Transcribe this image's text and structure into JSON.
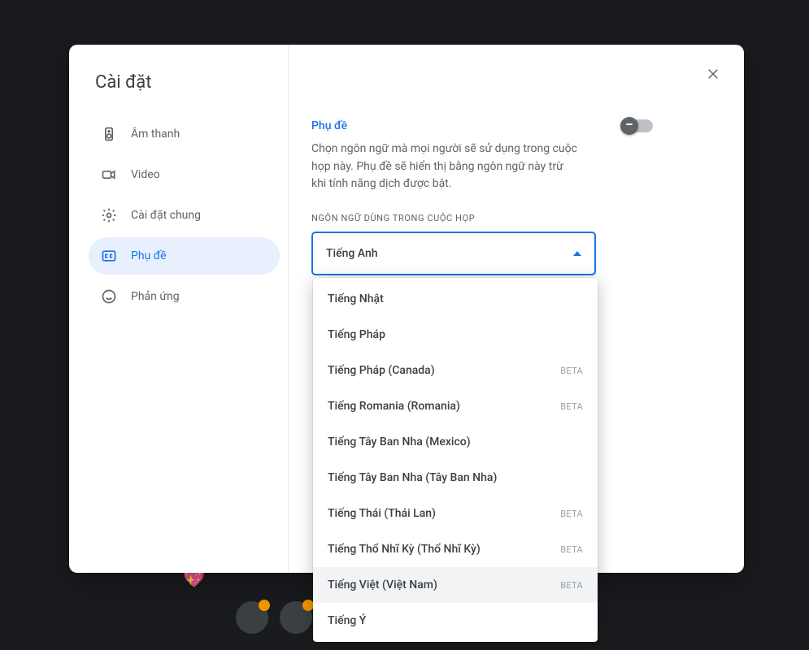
{
  "dialog": {
    "title": "Cài đặt",
    "nav": [
      {
        "label": "Âm thanh",
        "icon": "speaker"
      },
      {
        "label": "Video",
        "icon": "video"
      },
      {
        "label": "Cài đặt chung",
        "icon": "gear"
      },
      {
        "label": "Phụ đề",
        "icon": "captions",
        "active": true
      },
      {
        "label": "Phản ứng",
        "icon": "emoji"
      }
    ]
  },
  "captions": {
    "section_title": "Phụ đề",
    "toggle_on": false,
    "description": "Chọn ngôn ngữ mà mọi người sẽ sử dụng trong cuộc họp này. Phụ đề sẽ hiển thị bằng ngôn ngữ này trừ khi tính năng dịch được bật.",
    "field_label": "NGÔN NGỮ DÙNG TRONG CUỘC HỌP",
    "selected": "Tiếng Anh",
    "options": [
      {
        "label": "Tiếng Nhật"
      },
      {
        "label": "Tiếng Pháp"
      },
      {
        "label": "Tiếng Pháp (Canada)",
        "badge": "BETA"
      },
      {
        "label": "Tiếng Romania (Romania)",
        "badge": "BETA"
      },
      {
        "label": "Tiếng Tây Ban Nha (Mexico)"
      },
      {
        "label": "Tiếng Tây Ban Nha (Tây Ban Nha)"
      },
      {
        "label": "Tiếng Thái (Thái Lan)",
        "badge": "BETA"
      },
      {
        "label": "Tiếng Thổ Nhĩ Kỳ (Thổ Nhĩ Kỳ)",
        "badge": "BETA"
      },
      {
        "label": "Tiếng Việt (Việt Nam)",
        "badge": "BETA",
        "highlight": true
      },
      {
        "label": "Tiếng Ý"
      }
    ]
  }
}
